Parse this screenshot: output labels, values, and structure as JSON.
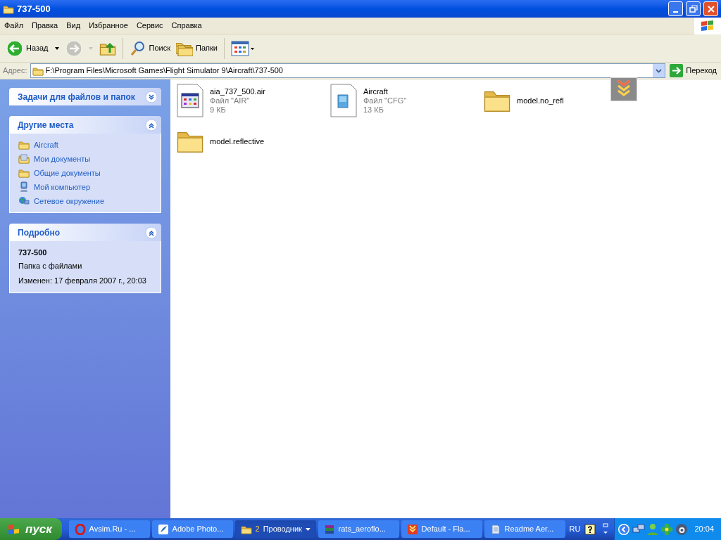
{
  "window": {
    "title": "737-500"
  },
  "menu": [
    "Файл",
    "Правка",
    "Вид",
    "Избранное",
    "Сервис",
    "Справка"
  ],
  "toolbar": [
    {
      "kind": "back",
      "label": "Назад",
      "disabled": false
    },
    {
      "kind": "forward",
      "disabled": true
    },
    {
      "kind": "up",
      "disabled": false
    },
    {
      "kind": "search",
      "label": "Поиск",
      "disabled": false
    },
    {
      "kind": "folders",
      "label": "Папки",
      "disabled": false
    },
    {
      "kind": "views",
      "disabled": false
    }
  ],
  "address": {
    "label": "Адрес:",
    "value": "F:\\Program Files\\Microsoft Games\\Flight Simulator 9\\Aircraft\\737-500",
    "go": "Переход"
  },
  "sidebar": {
    "panels": [
      {
        "kind": "tasks",
        "title": "Задачи для файлов и папок",
        "expanded": false
      },
      {
        "kind": "places",
        "title": "Другие места",
        "expanded": true,
        "items": [
          {
            "kind": "folder",
            "label": "Aircraft"
          },
          {
            "kind": "documents",
            "label": "Мои документы"
          },
          {
            "kind": "folder",
            "label": "Общие документы"
          },
          {
            "kind": "computer",
            "label": "Мой компьютер"
          },
          {
            "kind": "network",
            "label": "Сетевое окружение"
          }
        ]
      },
      {
        "kind": "details",
        "title": "Подробно",
        "expanded": true,
        "name": "737-500",
        "type": "Папка с файлами",
        "modified": "Изменен: 17 февраля 2007 г., 20:03"
      }
    ]
  },
  "files": [
    {
      "kind": "app",
      "name": "aia_737_500.air",
      "type": "Файл \"AIR\"",
      "size": "9 КБ"
    },
    {
      "kind": "doc",
      "name": "Aircraft",
      "type": "Файл \"CFG\"",
      "size": "13 КБ"
    },
    {
      "kind": "folder",
      "name": "model.no_refl"
    },
    {
      "kind": "folder",
      "name": "model.reflective"
    }
  ],
  "taskbar": {
    "start": "пуск",
    "tasks": [
      {
        "kind": "opera",
        "label": "Avsim.Ru - ...",
        "selected": false
      },
      {
        "kind": "photoshop",
        "label": "Adobe Photo...",
        "selected": false
      },
      {
        "kind": "folder",
        "count": "2",
        "label": "Проводник",
        "selected": true
      },
      {
        "kind": "archive",
        "label": "rats_aeroflo...",
        "selected": false
      },
      {
        "kind": "flashget",
        "label": "Default - Fla...",
        "selected": false
      },
      {
        "kind": "notepad",
        "label": "Readme Aer...",
        "selected": false
      }
    ],
    "language": "RU",
    "time": "20:04"
  }
}
